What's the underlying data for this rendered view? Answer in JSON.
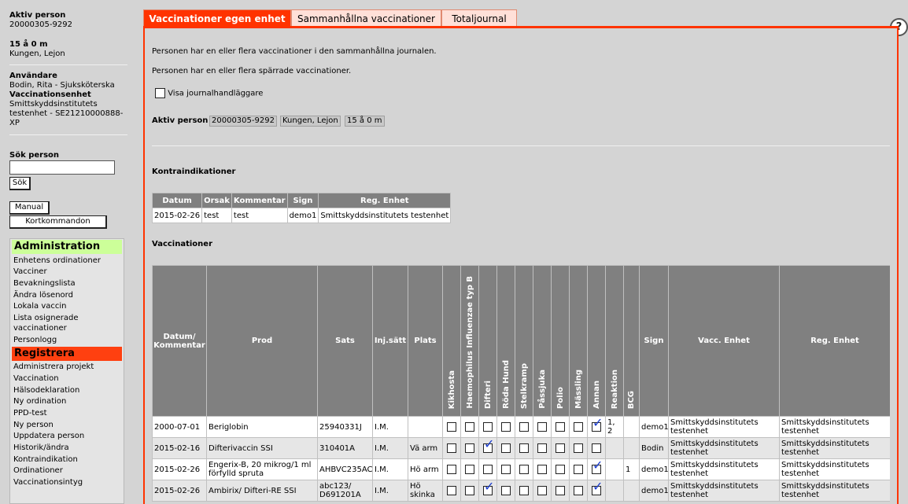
{
  "sidebar": {
    "active_person_label": "Aktiv person",
    "active_person_id": "20000305-9292",
    "active_person_age": "15 å 0 m",
    "active_person_name": "Kungen, Lejon",
    "user_label": "Användare",
    "user_name": "Bodin, Rita - Sjuksköterska",
    "unit_label": "Vaccinationsenhet",
    "unit_name_1": "Smittskyddsinstitutets",
    "unit_name_2": "testenhet - SE21210000888-",
    "unit_name_3": "XP",
    "search_label": "Sök person",
    "search_value": "",
    "search_button": "Sök",
    "manual_button": "Manual",
    "shortcut_button": "Kortkommandon"
  },
  "menu": {
    "admin_header": "Administration",
    "admin_items": [
      "Enhetens ordinationer",
      "Vacciner",
      "Bevakningslista",
      "Ändra lösenord",
      "Lokala vaccin",
      "Lista osignerade vaccinationer",
      "Personlogg"
    ],
    "register_header": "Registrera",
    "register_items": [
      "Administrera projekt",
      "Vaccination",
      "Hälsodeklaration",
      "Ny ordination",
      "PPD-test",
      "Ny person",
      "Uppdatera person",
      "Historik/ändra",
      "Kontraindikation",
      "Ordinationer",
      "Vaccinationsintyg"
    ]
  },
  "tabs": [
    "Vaccinationer egen enhet",
    "Sammanhållna vaccinationer",
    "Totaljournal"
  ],
  "messages": {
    "msg1": "Personen har en eller flera vaccinationer i den sammanhållna journalen.",
    "msg2": "Personen har en eller flera spärrade vaccinationer.",
    "show_handlers_label": "Visa journalhandläggare"
  },
  "active_person_bar": {
    "label": "Aktiv person",
    "id": "20000305-9292",
    "name": "Kungen, Lejon",
    "age": "15 å 0 m"
  },
  "kontra": {
    "title": "Kontraindikationer",
    "headers": [
      "Datum",
      "Orsak",
      "Kommentar",
      "Sign",
      "Reg. Enhet"
    ],
    "rows": [
      [
        "2015-02-26",
        "test",
        "test",
        "demo1",
        "Smittskyddsinstitutets testenhet"
      ]
    ]
  },
  "vacc": {
    "title": "Vaccinationer",
    "headers": {
      "date": "Datum/ Kommentar",
      "prod": "Prod",
      "sats": "Sats",
      "inj": "Inj.sätt",
      "plats": "Plats",
      "diseases": [
        "Kikhosta",
        "Haemophilus Influenzae typ B",
        "Difteri",
        "Röda Hund",
        "Stelkramp",
        "Påssjuka",
        "Polio",
        "Mässling",
        "Annan"
      ],
      "reaktion": "Reaktion",
      "bcg": "BCG",
      "sign": "Sign",
      "vacc_enhet": "Vacc. Enhet",
      "reg_enhet": "Reg. Enhet"
    },
    "rows": [
      {
        "date": "2000-07-01",
        "prod": "Beriglobin",
        "sats": "25940331J",
        "inj": "I.M.",
        "plats": "",
        "checks": [
          false,
          false,
          false,
          false,
          false,
          false,
          false,
          false,
          true
        ],
        "reaktion": "1, 2",
        "bcg": "",
        "sign": "demo1",
        "vacc_enhet": "Smittskyddsinstitutets testenhet",
        "reg_enhet": "Smittskyddsinstitutets testenhet"
      },
      {
        "date": "2015-02-16",
        "prod": "Difterivaccin SSI",
        "sats": "310401A",
        "inj": "I.M.",
        "plats": "Vä arm",
        "checks": [
          false,
          false,
          true,
          false,
          false,
          false,
          false,
          false,
          false
        ],
        "reaktion": "",
        "bcg": "",
        "sign": "Bodin",
        "vacc_enhet": "Smittskyddsinstitutets testenhet",
        "reg_enhet": "Smittskyddsinstitutets testenhet"
      },
      {
        "date": "2015-02-26",
        "prod": "Engerix-B, 20 mikrog/1 ml förfylld spruta",
        "sats": "AHBVC235AC",
        "inj": "I.M.",
        "plats": "Hö arm",
        "checks": [
          false,
          false,
          false,
          false,
          false,
          false,
          false,
          false,
          true
        ],
        "reaktion": "",
        "bcg": "1",
        "sign": "demo1",
        "vacc_enhet": "Smittskyddsinstitutets testenhet",
        "reg_enhet": "Smittskyddsinstitutets testenhet"
      },
      {
        "date": "2015-02-26",
        "prod": "Ambirix/ Difteri-RE SSI",
        "sats": "abc123/ D691201A",
        "inj": "I.M.",
        "plats": "Hö skinka",
        "checks": [
          false,
          false,
          true,
          false,
          false,
          false,
          false,
          false,
          true
        ],
        "reaktion": "",
        "bcg": "",
        "sign": "demo1",
        "vacc_enhet": "Smittskyddsinstitutets testenhet",
        "reg_enhet": "Smittskyddsinstitutets testenhet"
      }
    ]
  },
  "colors": {
    "accent": "#ff3300",
    "admin_header": "#ccff99",
    "checkmark": "#1a3ccf"
  }
}
